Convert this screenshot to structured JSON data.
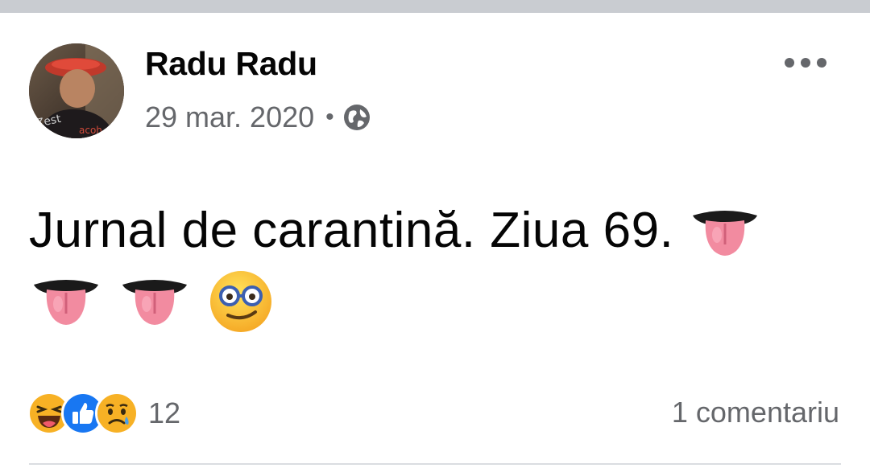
{
  "post": {
    "author": "Radu Radu",
    "date": "29 mar. 2020",
    "separator": "•",
    "privacy_icon": "globe-icon",
    "more_icon": "more-options-icon",
    "text": "Jurnal de carantină. Ziua 69.",
    "emojis": [
      "tongue-emoji",
      "tongue-emoji",
      "tongue-emoji",
      "nerd-face-emoji"
    ],
    "reactions": {
      "icons": [
        "haha-reaction-icon",
        "like-reaction-icon",
        "sad-reaction-icon"
      ],
      "count": "12"
    },
    "comments_label": "1 comentariu"
  },
  "colors": {
    "text": "#050505",
    "secondary": "#65676b",
    "like_blue": "#1877f2",
    "reaction_yellow": "#f7b125",
    "top_bar": "#c9ccd1"
  }
}
